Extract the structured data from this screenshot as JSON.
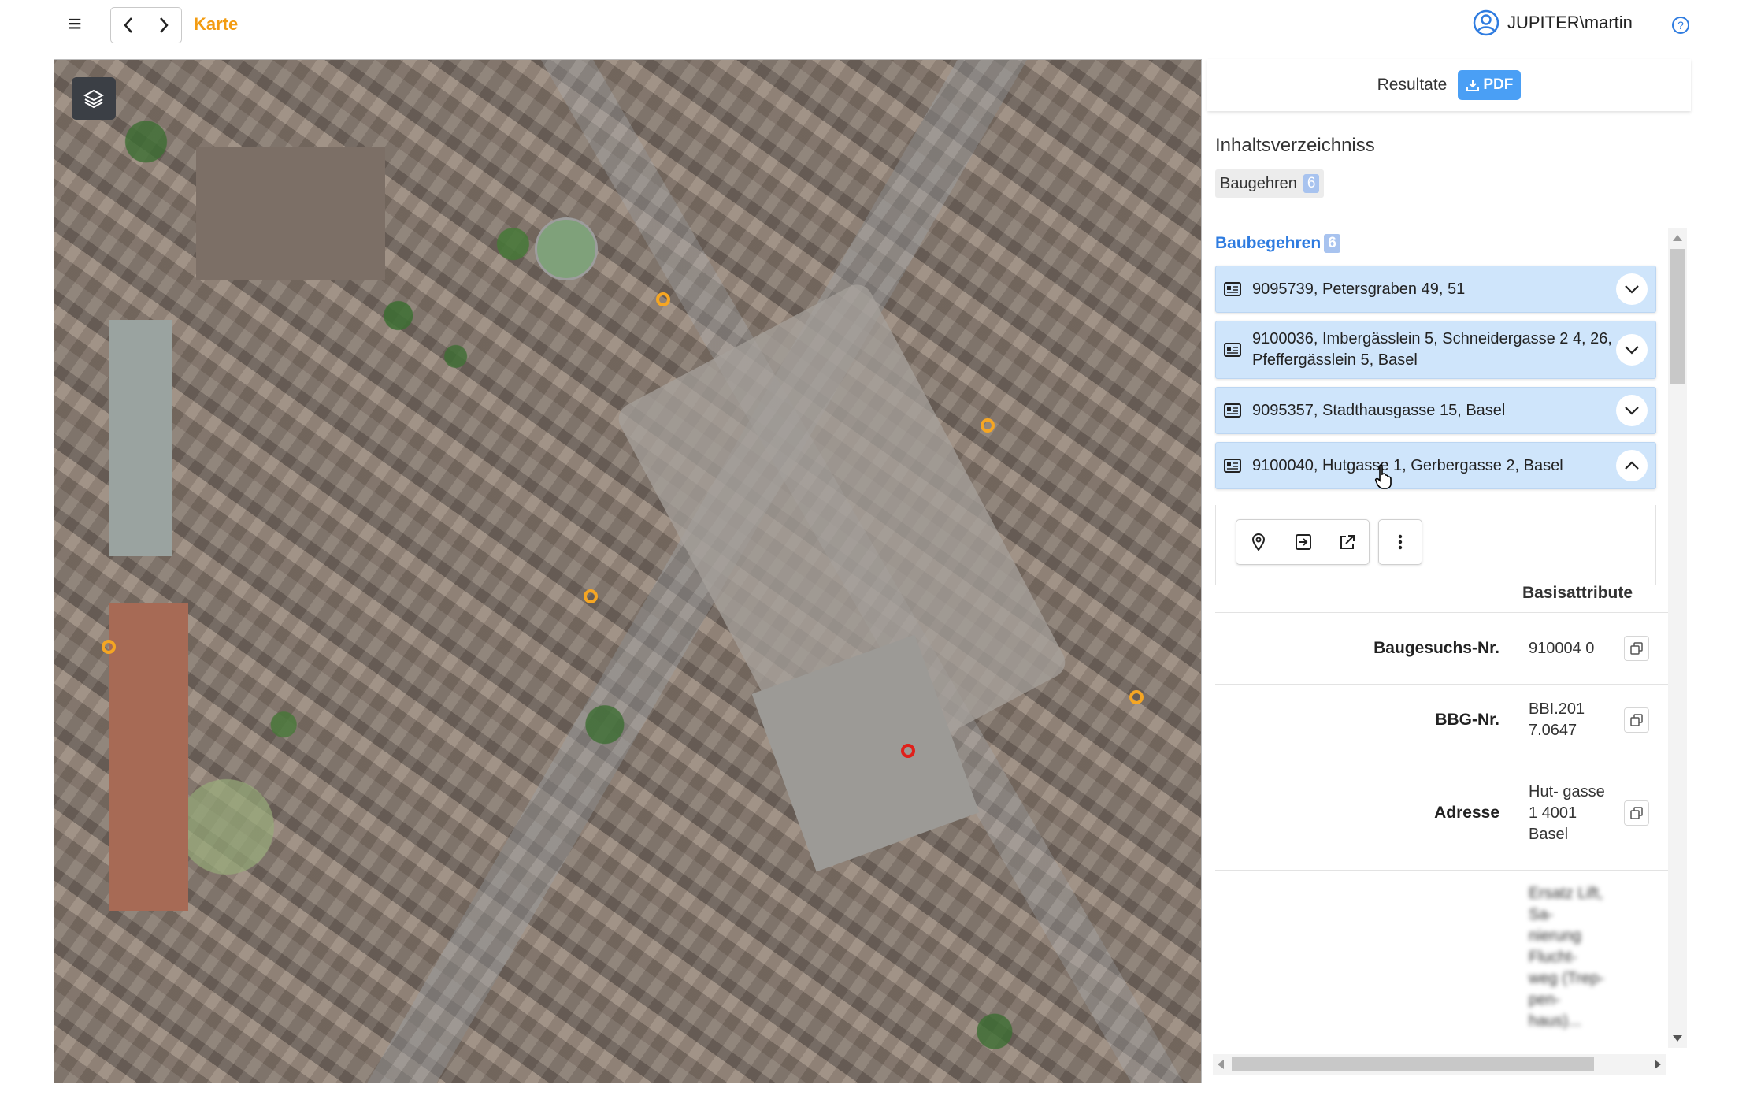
{
  "header": {
    "menu_icon": "menu-icon",
    "back_icon": "chevron-left-icon",
    "forward_icon": "chevron-right-icon",
    "breadcrumb": "Karte",
    "user_name": "JUPITER\\martin",
    "user_icon": "account-circle-icon",
    "help_icon": "help-icon",
    "accent_color": "#f39c12"
  },
  "map": {
    "layers_icon": "layers-icon",
    "marker_color": "#f5a623",
    "selected_marker_color": "#e0201a"
  },
  "results": {
    "title": "Resultate",
    "pdf_label": "PDF",
    "toc_title": "Inhaltsverzeichniss",
    "toc_chip_label": "Baugehren",
    "toc_chip_count": "6",
    "section_title": "Baubegehren",
    "section_count": "6",
    "items": [
      {
        "label": "9095739, Petersgraben 49, 51",
        "expanded": false
      },
      {
        "label": "9100036, Imbergässlein 5, Schneidergasse 2 4, 26, Pfeffergässlein 5, Basel",
        "expanded": false
      },
      {
        "label": "9095357, Stadthausgasse 15, Basel",
        "expanded": false
      },
      {
        "label": "9100040, Hutgasse 1, Gerbergasse 2, Basel",
        "expanded": true
      }
    ],
    "actions": [
      "map-pin-icon",
      "open-in-panel-icon",
      "external-link-icon",
      "more-vert-icon"
    ],
    "table": {
      "header": "Basisattribute",
      "rows": [
        {
          "key": "Baugesuchs-Nr.",
          "value": "910004 0"
        },
        {
          "key": "BBG-Nr.",
          "value": "BBI.201 7.0647"
        },
        {
          "key": "Adresse",
          "value": "Hut- gasse 1 4001 Basel"
        },
        {
          "key": "",
          "value": "Ersatz Lift, Sa- nierung Flucht- weg (Trep- pen- haus)..."
        }
      ]
    }
  }
}
